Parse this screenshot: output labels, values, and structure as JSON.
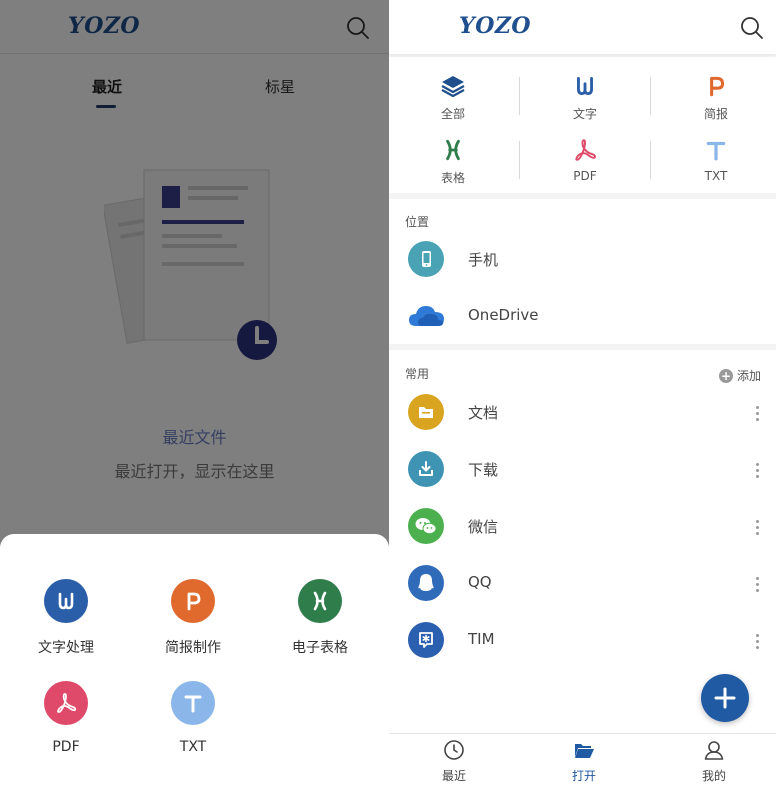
{
  "colors": {
    "brand": "#1f4f8c",
    "accent": "#1f5aa3",
    "word": "#2a5ea8",
    "presentation": "#e0692e",
    "spreadsheet": "#2e7d4a",
    "pdf": "#e04a6a",
    "txt": "#8ab6ea"
  },
  "left": {
    "logo": "YOZO",
    "tabs": [
      {
        "label": "最近",
        "active": true
      },
      {
        "label": "标星",
        "active": false
      }
    ],
    "empty": {
      "title": "最近文件",
      "subtitle": "最近打开，显示在这里"
    },
    "create_sheet": {
      "items": [
        {
          "label": "文字处理",
          "icon": "word-icon"
        },
        {
          "label": "简报制作",
          "icon": "presentation-icon"
        },
        {
          "label": "电子表格",
          "icon": "spreadsheet-icon"
        },
        {
          "label": "PDF",
          "icon": "pdf-icon"
        },
        {
          "label": "TXT",
          "icon": "txt-icon"
        }
      ]
    }
  },
  "right": {
    "logo": "YOZO",
    "types": [
      {
        "label": "全部",
        "icon": "layers-icon"
      },
      {
        "label": "文字",
        "icon": "word-icon"
      },
      {
        "label": "简报",
        "icon": "presentation-icon"
      },
      {
        "label": "表格",
        "icon": "spreadsheet-icon"
      },
      {
        "label": "PDF",
        "icon": "pdf-icon"
      },
      {
        "label": "TXT",
        "icon": "txt-icon"
      }
    ],
    "location": {
      "title": "位置",
      "items": [
        {
          "label": "手机",
          "icon": "phone-icon"
        },
        {
          "label": "OneDrive",
          "icon": "cloud-icon"
        }
      ]
    },
    "common": {
      "title": "常用",
      "add_label": "添加",
      "items": [
        {
          "label": "文档",
          "icon": "folder-icon"
        },
        {
          "label": "下载",
          "icon": "download-icon"
        },
        {
          "label": "微信",
          "icon": "wechat-icon"
        },
        {
          "label": "QQ",
          "icon": "qq-icon"
        },
        {
          "label": "TIM",
          "icon": "tim-icon"
        }
      ]
    },
    "nav": [
      {
        "label": "最近",
        "icon": "clock-icon",
        "active": false
      },
      {
        "label": "打开",
        "icon": "folder-open-icon",
        "active": true
      },
      {
        "label": "我的",
        "icon": "user-icon",
        "active": false
      }
    ]
  }
}
